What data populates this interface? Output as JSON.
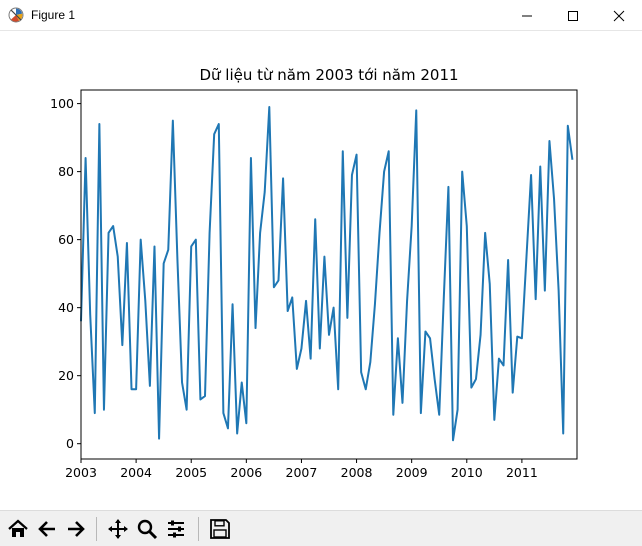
{
  "window": {
    "title": "Figure 1"
  },
  "toolbar": {
    "buttons": [
      {
        "name": "home-icon"
      },
      {
        "name": "back-arrow-icon"
      },
      {
        "name": "forward-arrow-icon"
      },
      {
        "name": "pan-icon"
      },
      {
        "name": "zoom-icon"
      },
      {
        "name": "configure-subplots-icon"
      },
      {
        "name": "save-icon"
      }
    ]
  },
  "chart_data": {
    "type": "line",
    "title": "Dữ liệu từ năm 2003 tới năm 2011",
    "xlabel": "",
    "ylabel": "",
    "color": "#1f77b4",
    "xlim": [
      0,
      108
    ],
    "ylim": [
      -4.5,
      104
    ],
    "x_ticks": [
      {
        "label": "2003",
        "value": 0
      },
      {
        "label": "2004",
        "value": 12
      },
      {
        "label": "2005",
        "value": 24
      },
      {
        "label": "2006",
        "value": 36
      },
      {
        "label": "2007",
        "value": 48
      },
      {
        "label": "2008",
        "value": 60
      },
      {
        "label": "2009",
        "value": 72
      },
      {
        "label": "2010",
        "value": 84
      },
      {
        "label": "2011",
        "value": 96
      }
    ],
    "y_ticks": [
      0,
      20,
      40,
      60,
      80,
      100
    ],
    "grid": false,
    "x_unit": "month index starting January 2003",
    "values": [
      36,
      84,
      38,
      9,
      94,
      10,
      62,
      64,
      55,
      29,
      59,
      16,
      16,
      60,
      42,
      17,
      58,
      1.5,
      53,
      57,
      95,
      54,
      18,
      10,
      58,
      60,
      13,
      14,
      62,
      91,
      94,
      9,
      4.5,
      41,
      3,
      18,
      6,
      84,
      34,
      62,
      74,
      99,
      46,
      48,
      78,
      39,
      43,
      22,
      28,
      42,
      25,
      66,
      28,
      55,
      32,
      40,
      16,
      86,
      37,
      79,
      85,
      21,
      16,
      24,
      41,
      62,
      80,
      86,
      8.5,
      31,
      12,
      42,
      64,
      98,
      9,
      33,
      31,
      19,
      8.5,
      43,
      75.5,
      1,
      10,
      80,
      64,
      16.5,
      19,
      32,
      62,
      47,
      7,
      25,
      23,
      54,
      15,
      31.5,
      31,
      55,
      79,
      42.5,
      81.5,
      45,
      89,
      72,
      45,
      3,
      93.5,
      83.5
    ]
  }
}
